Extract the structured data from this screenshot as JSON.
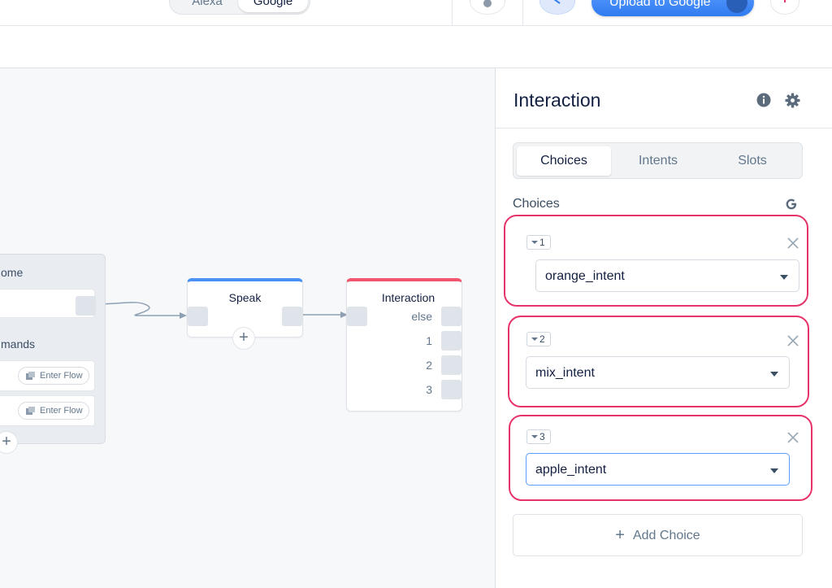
{
  "topbar": {
    "platforms": [
      "Alexa",
      "Google"
    ],
    "active_platform": "Google",
    "upload_label": "Upload to Google"
  },
  "canvas": {
    "group": {
      "label_top": "ome",
      "label_bottom": "mands",
      "commands": [
        {
          "label": "Enter Flow"
        },
        {
          "label": "Enter Flow"
        }
      ]
    },
    "speak_node": {
      "title": "Speak",
      "accent": "#4a90f5"
    },
    "interaction_node": {
      "title": "Interaction",
      "accent": "#f0566e",
      "ports": [
        "else",
        "1",
        "2",
        "3"
      ]
    }
  },
  "panel": {
    "title": "Interaction",
    "tabs": [
      {
        "label": "Choices",
        "active": true
      },
      {
        "label": "Intents",
        "active": false
      },
      {
        "label": "Slots",
        "active": false
      }
    ],
    "section_label": "Choices",
    "platform_icon": "google-g-icon",
    "choices": [
      {
        "index": "1",
        "intent": "orange_intent"
      },
      {
        "index": "2",
        "intent": "mix_intent"
      },
      {
        "index": "3",
        "intent": "apple_intent"
      }
    ],
    "add_choice_label": "Add Choice",
    "highlight_color": "#e8336a"
  }
}
